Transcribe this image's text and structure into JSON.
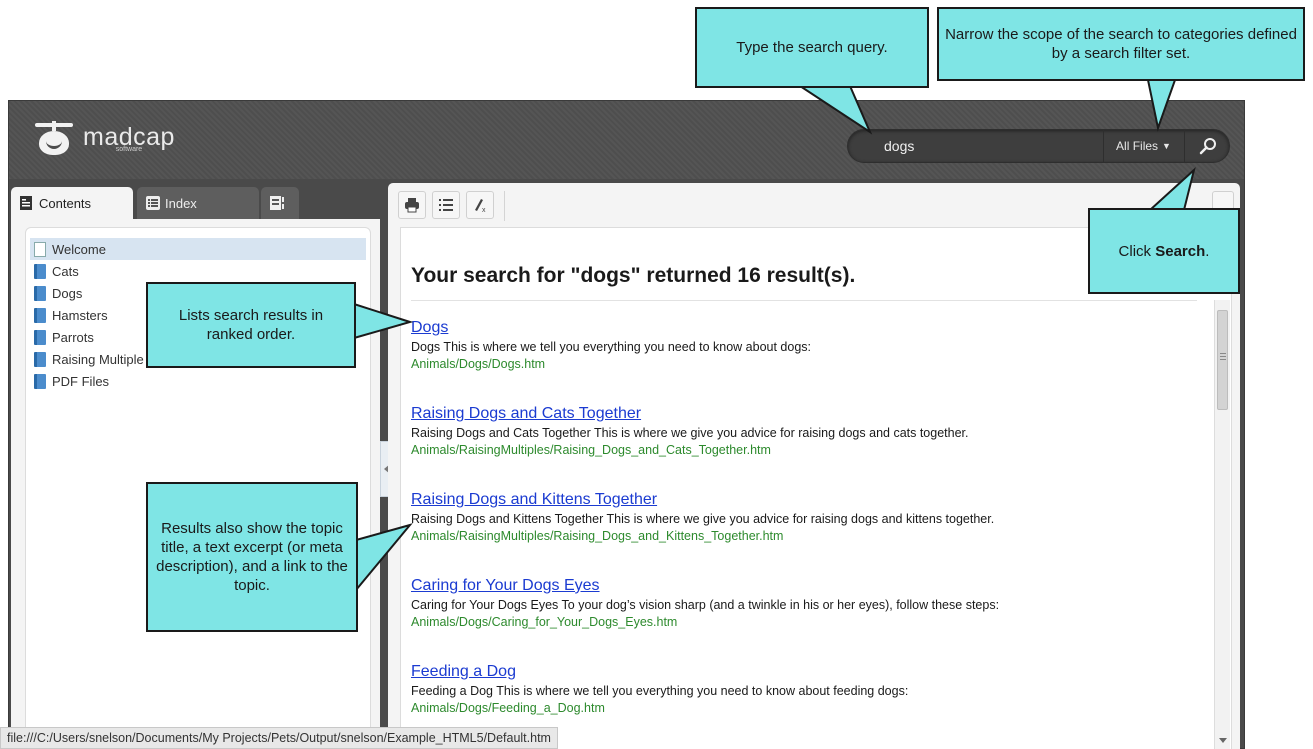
{
  "header": {
    "logo_text": "madcap",
    "logo_subtext": "software"
  },
  "search": {
    "query": "dogs",
    "filter_label": "All Files"
  },
  "tabs": {
    "contents": "Contents",
    "index": "Index"
  },
  "toc": [
    "Welcome",
    "Cats",
    "Dogs",
    "Hamsters",
    "Parrots",
    "Raising Multiple Pets",
    "PDF Files"
  ],
  "results": {
    "heading": "Your search for \"dogs\" returned 16 result(s).",
    "items": [
      {
        "title": "Dogs",
        "excerpt": "Dogs This is where we tell you everything you need to know about dogs:",
        "url": "Animals/Dogs/Dogs.htm"
      },
      {
        "title": "Raising Dogs and Cats Together",
        "excerpt": "Raising Dogs and Cats Together This is where we give you advice for raising dogs and cats together.",
        "url": "Animals/RaisingMultiples/Raising_Dogs_and_Cats_Together.htm"
      },
      {
        "title": "Raising Dogs and Kittens Together",
        "excerpt": "Raising Dogs and Kittens Together This is where we give you advice for raising dogs and kittens together.",
        "url": "Animals/RaisingMultiples/Raising_Dogs_and_Kittens_Together.htm"
      },
      {
        "title": "Caring for Your Dogs Eyes",
        "excerpt": "Caring for Your Dogs Eyes To your dog’s vision sharp (and a twinkle in his or her eyes), follow these steps:",
        "url": "Animals/Dogs/Caring_for_Your_Dogs_Eyes.htm"
      },
      {
        "title": "Feeding a Dog",
        "excerpt": "Feeding a Dog This is where we tell you everything you need to know about feeding dogs:",
        "url": "Animals/Dogs/Feeding_a_Dog.htm"
      }
    ]
  },
  "status_url": "file:///C:/Users/snelson/Documents/My Projects/Pets/Output/snelson/Example_HTML5/Default.htm",
  "callouts": {
    "search_query": "Type the search query.",
    "search_filter": "Narrow the scope of the search to categories defined by a search filter set.",
    "click_prefix": "Click",
    "click_bold": "Search",
    "click_suffix": ".",
    "ranked": "Lists search results in ranked order.",
    "details": "Results also show the topic title, a text excerpt (or meta description), and a link to the topic."
  },
  "colors": {
    "callout_fill": "#7fe5e5",
    "link": "#1b3bd1",
    "url_green": "#2d8a2d",
    "header_bg": "#4e4e4e"
  }
}
